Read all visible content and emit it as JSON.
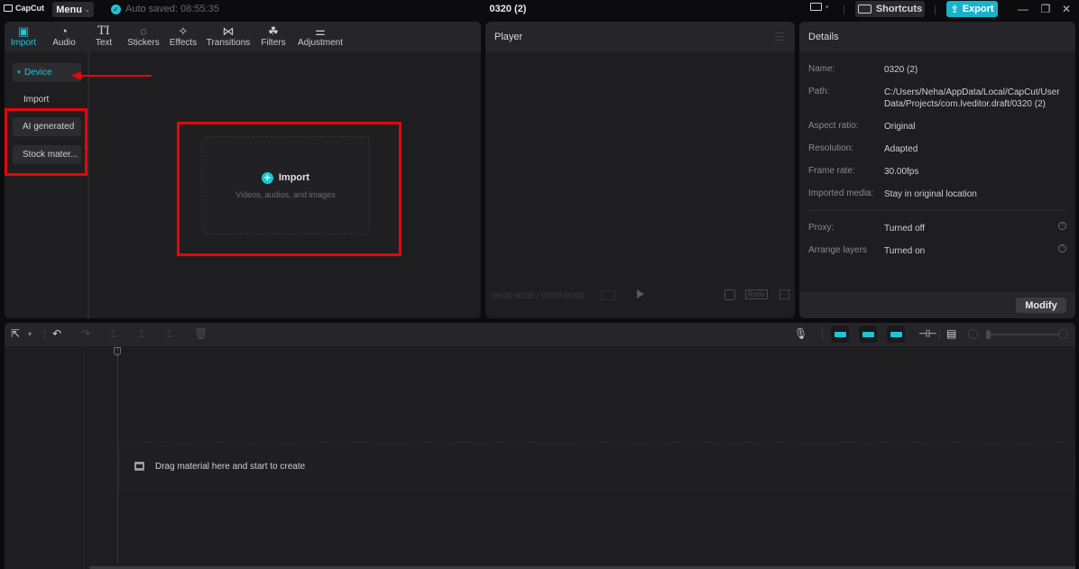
{
  "titlebar": {
    "app_name": "CapCut",
    "menu_label": "Menu",
    "autosave_text": "Auto saved: 08:55:35",
    "project_title": "0320 (2)",
    "shortcuts_label": "Shortcuts",
    "export_label": "Export",
    "colors": {
      "accent": "#1fc4d6",
      "export_bg": "#17b3c8"
    }
  },
  "media": {
    "tabs": [
      {
        "label": "Import",
        "icon": "import-icon",
        "glyph": "▣",
        "active": true
      },
      {
        "label": "Audio",
        "icon": "audio-icon",
        "glyph": "◔"
      },
      {
        "label": "Text",
        "icon": "text-icon",
        "glyph": "TI"
      },
      {
        "label": "Stickers",
        "icon": "sticker-icon",
        "glyph": "◌"
      },
      {
        "label": "Effects",
        "icon": "effects-icon",
        "glyph": "✧"
      },
      {
        "label": "Transitions",
        "icon": "transitions-icon",
        "glyph": "⋈"
      },
      {
        "label": "Filters",
        "icon": "filters-icon",
        "glyph": "☘"
      },
      {
        "label": "Adjustment",
        "icon": "adjustment-icon",
        "glyph": "⚌"
      }
    ],
    "sidebar": {
      "device": "Device",
      "import": "Import",
      "ai_generated": "AI generated",
      "stock": "Stock mater..."
    },
    "dropzone": {
      "title": "Import",
      "subtitle": "Videos, audios, and images"
    }
  },
  "player": {
    "title": "Player",
    "timecode": "00:00:00:00 / 00:00:00:00",
    "ratio_label": "Ratio"
  },
  "details": {
    "title": "Details",
    "rows": [
      {
        "key": "Name:",
        "value": "0320 (2)"
      },
      {
        "key": "Path:",
        "value": "C:/Users/Neha/AppData/Local/CapCut/User Data/Projects/com.lveditor.draft/0320 (2)"
      },
      {
        "key": "Aspect ratio:",
        "value": "Original"
      },
      {
        "key": "Resolution:",
        "value": "Adapted"
      },
      {
        "key": "Frame rate:",
        "value": "30.00fps"
      },
      {
        "key": "Imported media:",
        "value": "Stay in original location"
      }
    ],
    "settings": [
      {
        "key": "Proxy:",
        "value": "Turned off"
      },
      {
        "key": "Arrange layers",
        "value": "Turned on"
      }
    ],
    "modify_label": "Modify"
  },
  "timeline": {
    "drop_hint": "Drag material here and start to create"
  }
}
